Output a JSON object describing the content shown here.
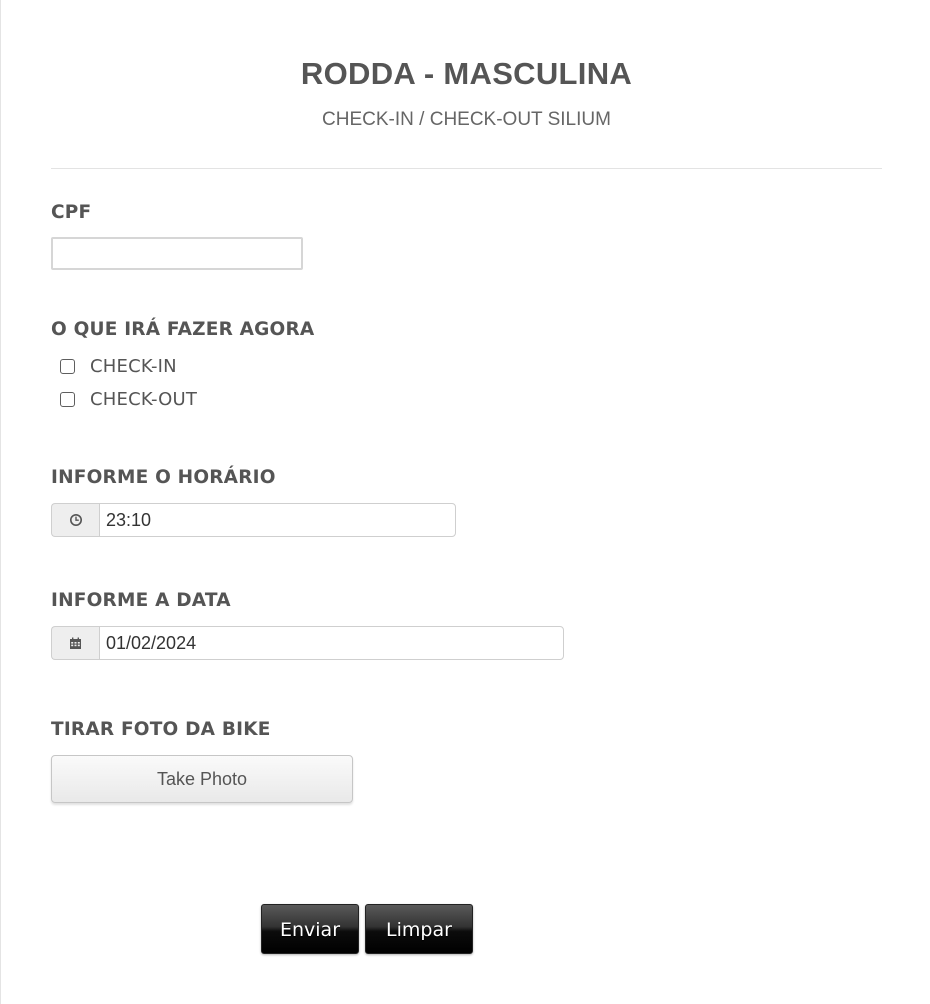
{
  "form": {
    "title": "RODDA - MASCULINA",
    "subtitle": "CHECK-IN / CHECK-OUT SILIUM"
  },
  "cpf": {
    "label": "CPF",
    "value": ""
  },
  "action": {
    "label": "O QUE IRÁ FAZER AGORA",
    "options": [
      {
        "label": "CHECK-IN",
        "checked": false
      },
      {
        "label": "CHECK-OUT",
        "checked": false
      }
    ]
  },
  "time": {
    "label": "INFORME O HORÁRIO",
    "icon": "clock-icon",
    "value": "23:10"
  },
  "date": {
    "label": "INFORME A DATA",
    "icon": "calendar-icon",
    "value": "01/02/2024"
  },
  "photo": {
    "label": "TIRAR FOTO DA BIKE",
    "button_label": "Take Photo"
  },
  "buttons": {
    "submit_label": "Enviar",
    "clear_label": "Limpar"
  }
}
